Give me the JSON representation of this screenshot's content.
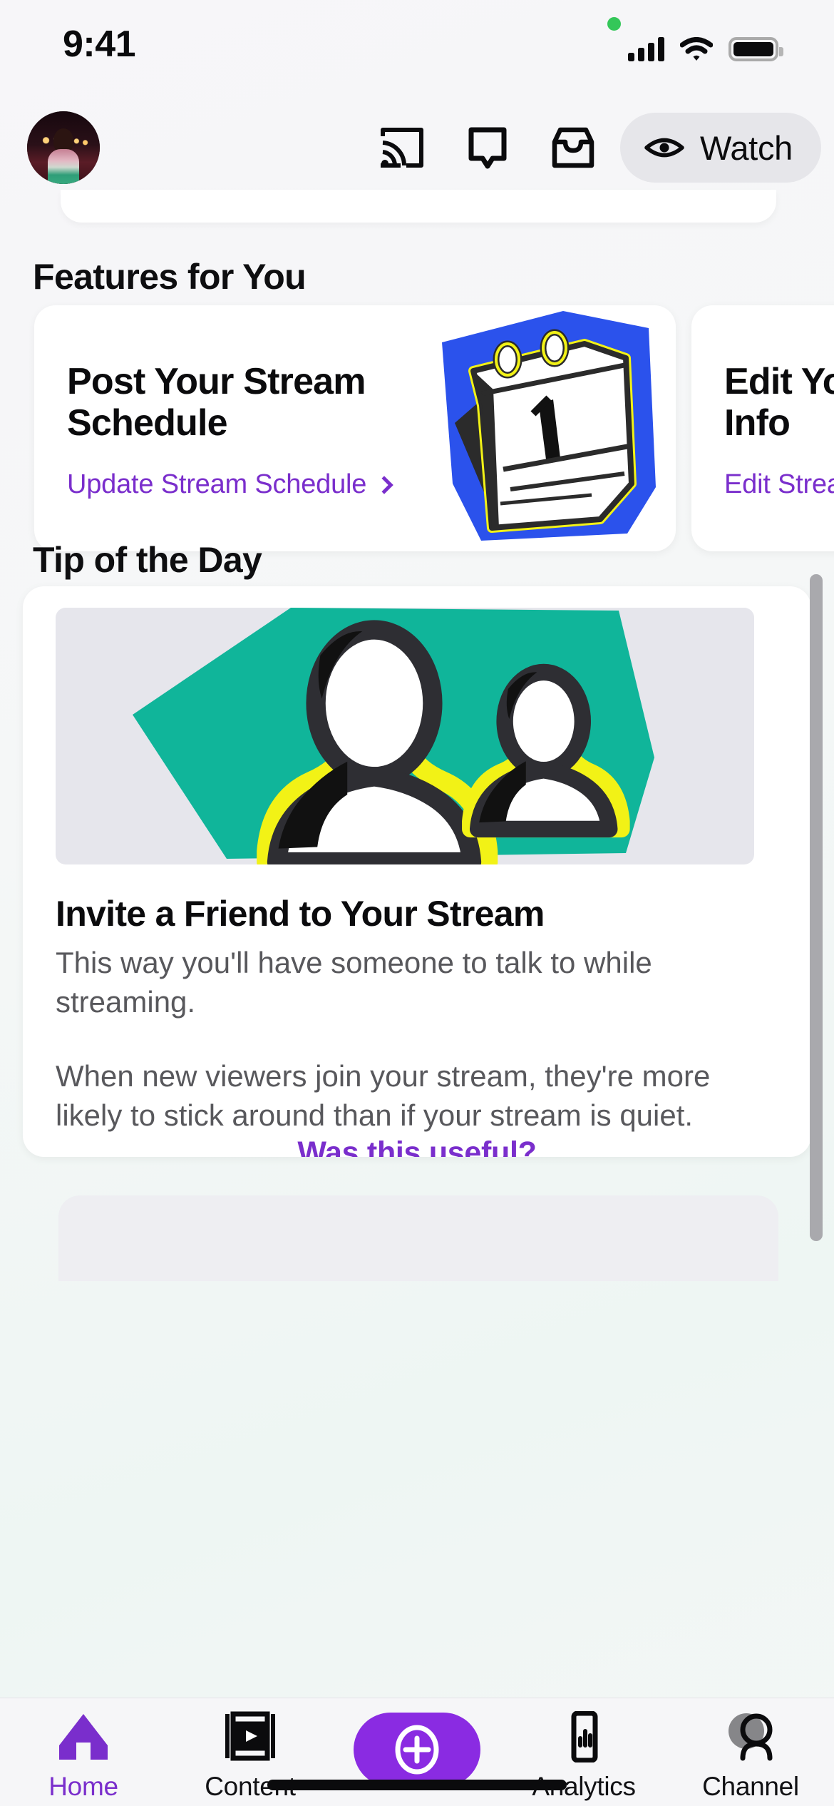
{
  "status_bar": {
    "time": "9:41",
    "signal_icon": "cellular-bars-icon",
    "wifi_icon": "wifi-icon",
    "battery_icon": "battery-full-icon",
    "recording_indicator": "green-dot-icon"
  },
  "top_nav": {
    "avatar": "user-avatar",
    "actions": [
      {
        "name": "cast-icon",
        "label": "Cast"
      },
      {
        "name": "chat-icon",
        "label": "Chat"
      },
      {
        "name": "inbox-icon",
        "label": "Inbox"
      }
    ],
    "watch_button": {
      "label": "Watch",
      "icon": "eye-icon"
    }
  },
  "features": {
    "section_title": "Features for You",
    "cards": [
      {
        "title": "Post Your Stream Schedule",
        "link": "Update Stream Schedule",
        "art": "calendar-illustration"
      },
      {
        "title": "Edit Your Stream Info",
        "link": "Edit Stream Info",
        "art": "edit-illustration"
      }
    ]
  },
  "tip": {
    "section_title": "Tip of the Day",
    "hero_art": "two-people-illustration",
    "title": "Invite a Friend to Your Stream",
    "paragraph_1": "This way you'll have someone to talk to while streaming.",
    "paragraph_2": "When new viewers join your stream, they're more likely to stick around than if your stream is quiet.",
    "cta": "Was this useful?"
  },
  "tab_bar": {
    "items": [
      {
        "label": "Home",
        "icon": "home-icon",
        "active": true
      },
      {
        "label": "Content",
        "icon": "film-strip-icon",
        "active": false
      },
      {
        "label": "",
        "icon": "plus-circle-icon",
        "active": false
      },
      {
        "label": "Analytics",
        "icon": "phone-chart-icon",
        "active": false
      },
      {
        "label": "Channel",
        "icon": "person-icon",
        "active": false
      }
    ]
  },
  "colors": {
    "accent_purple": "#7a2ecc",
    "create_purple": "#8a2be2",
    "illustration_blue": "#2b52ec",
    "illustration_teal": "#10b59a",
    "illustration_yellow": "#f2f216",
    "background": "#f6f6f8",
    "card": "#ffffff"
  }
}
